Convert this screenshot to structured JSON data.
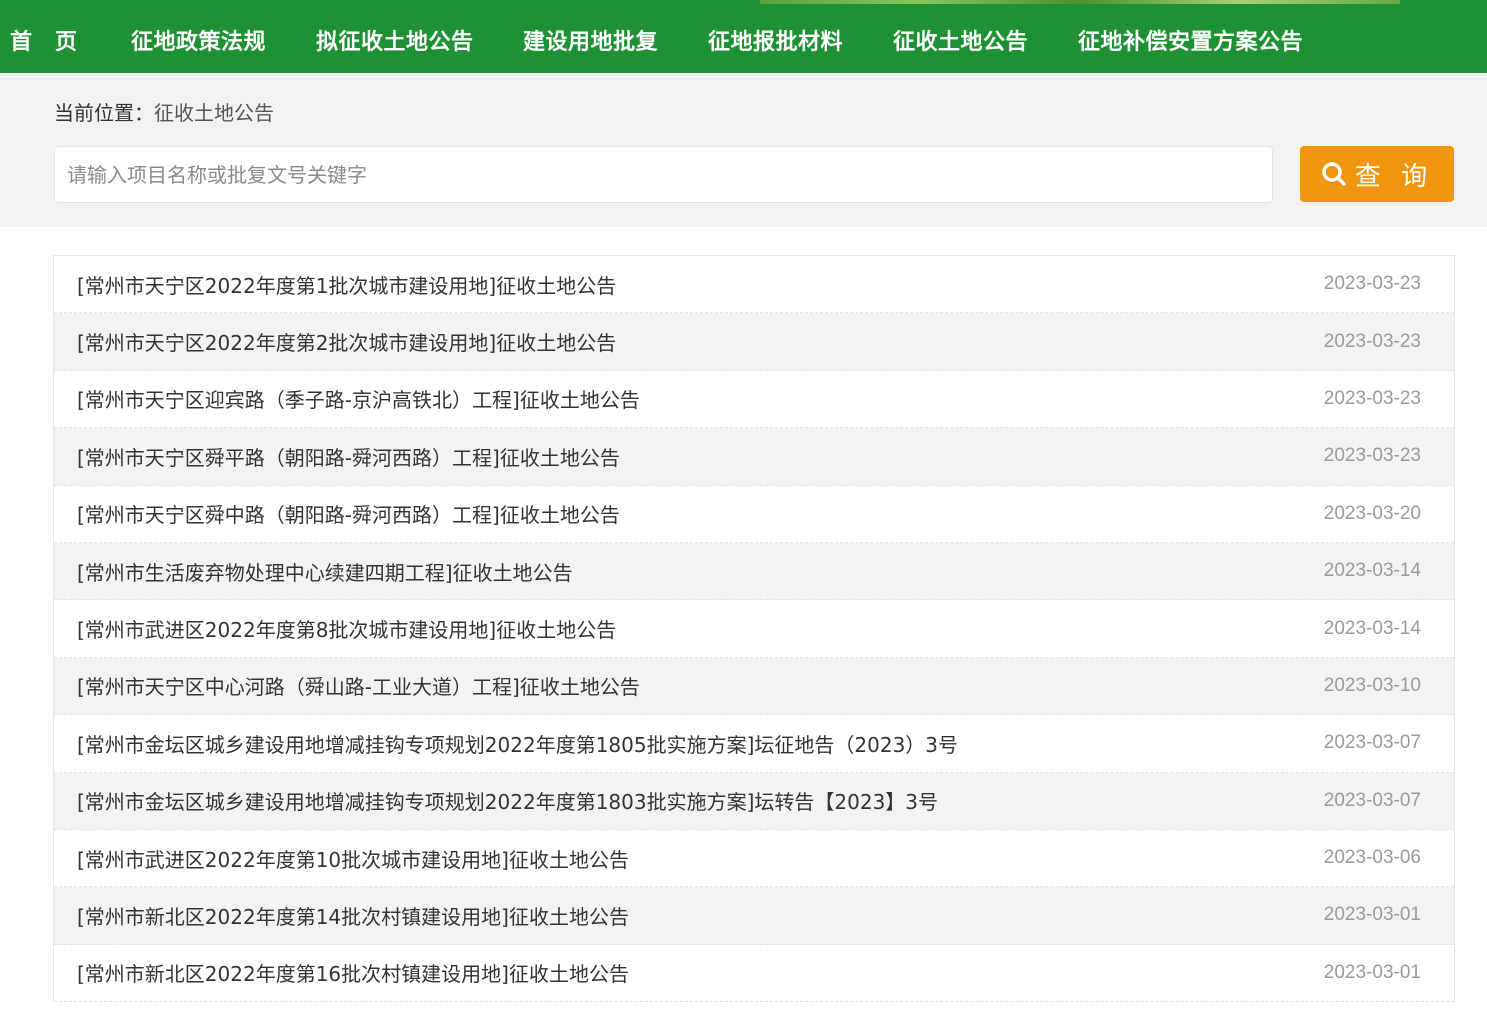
{
  "nav": {
    "items": [
      "首　页",
      "征地政策法规",
      "拟征收土地公告",
      "建设用地批复",
      "征地报批材料",
      "征收土地公告",
      "征地补偿安置方案公告"
    ]
  },
  "breadcrumb": {
    "prefix": "当前位置：",
    "current": "征收土地公告"
  },
  "search": {
    "placeholder": "请输入项目名称或批复文号关键字",
    "button_label": "查 询"
  },
  "colors": {
    "nav_bg": "#1f9135",
    "button_bg": "#f0950f"
  },
  "list": [
    {
      "title": "[常州市天宁区2022年度第1批次城市建设用地]征收土地公告",
      "date": "2023-03-23"
    },
    {
      "title": "[常州市天宁区2022年度第2批次城市建设用地]征收土地公告",
      "date": "2023-03-23"
    },
    {
      "title": "[常州市天宁区迎宾路（季子路-京沪高铁北）工程]征收土地公告",
      "date": "2023-03-23"
    },
    {
      "title": "[常州市天宁区舜平路（朝阳路-舜河西路）工程]征收土地公告",
      "date": "2023-03-23"
    },
    {
      "title": "[常州市天宁区舜中路（朝阳路-舜河西路）工程]征收土地公告",
      "date": "2023-03-20"
    },
    {
      "title": "[常州市生活废弃物处理中心续建四期工程]征收土地公告",
      "date": "2023-03-14"
    },
    {
      "title": "[常州市武进区2022年度第8批次城市建设用地]征收土地公告",
      "date": "2023-03-14"
    },
    {
      "title": "[常州市天宁区中心河路（舜山路-工业大道）工程]征收土地公告",
      "date": "2023-03-10"
    },
    {
      "title": "[常州市金坛区城乡建设用地增减挂钩专项规划2022年度第1805批实施方案]坛征地告（2023）3号",
      "date": "2023-03-07"
    },
    {
      "title": "[常州市金坛区城乡建设用地增减挂钩专项规划2022年度第1803批实施方案]坛转告【2023】3号",
      "date": "2023-03-07"
    },
    {
      "title": "[常州市武进区2022年度第10批次城市建设用地]征收土地公告",
      "date": "2023-03-06"
    },
    {
      "title": "[常州市新北区2022年度第14批次村镇建设用地]征收土地公告",
      "date": "2023-03-01"
    },
    {
      "title": "[常州市新北区2022年度第16批次村镇建设用地]征收土地公告",
      "date": "2023-03-01"
    }
  ]
}
